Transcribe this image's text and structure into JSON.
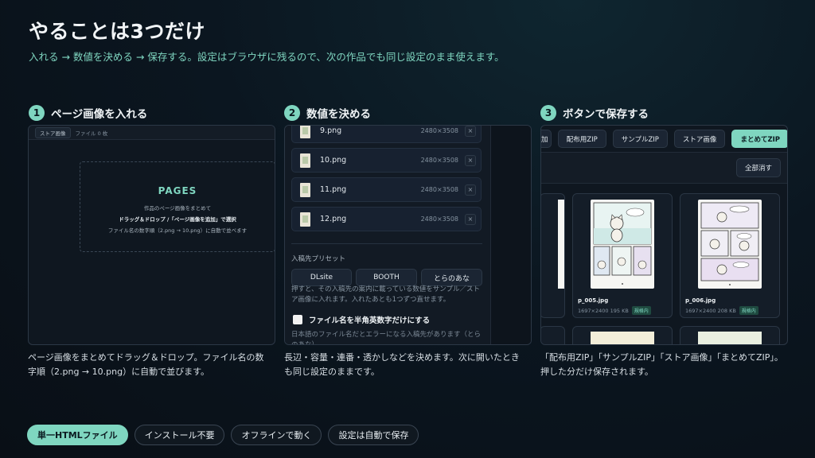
{
  "header": {
    "title": "やることは3つだけ",
    "subtitle": "入れる → 数値を決める → 保存する。設定はブラウザに残るので、次の作品でも同じ設定のまま使えます。"
  },
  "steps": [
    {
      "num": "1",
      "title": "ページ画像を入れる",
      "desc": "ページ画像をまとめてドラッグ＆ドロップ。ファイル名の数字順（2.png → 10.png）に自動で並びます。"
    },
    {
      "num": "2",
      "title": "数値を決める",
      "desc": "長辺・容量・連番・透かしなどを決めます。次に開いたときも同じ設定のままです。"
    },
    {
      "num": "3",
      "title": "ボタンで保存する",
      "desc": "「配布用ZIP」「サンプルZIP」「ストア画像」「まとめてZIP」。押した分だけ保存されます。"
    }
  ],
  "panel1": {
    "tab": "ストア画像",
    "count": "ファイル 0 枚",
    "drop_title": "PAGES",
    "drop_line1": "作品のページ画像をまとめて",
    "drop_line2": "ドラッグ＆ドロップ /「ページ画像を追加」で選択",
    "drop_line3": "ファイル名の数字順（2.png → 10.png）に自動で並べます"
  },
  "panel2": {
    "files": [
      {
        "name": "9.png",
        "size": "2480×3508"
      },
      {
        "name": "10.png",
        "size": "2480×3508"
      },
      {
        "name": "11.png",
        "size": "2480×3508"
      },
      {
        "name": "12.png",
        "size": "2480×3508"
      }
    ],
    "remove_symbol": "×",
    "preset_label": "入稿先プリセット",
    "presets": [
      "DLsite",
      "BOOTH",
      "とらのあな"
    ],
    "preset_note": "押すと、その入稿先の案内に載っている数値をサンプル／ストア画像に入れます。入れたあとも1つずつ直せます。",
    "checkbox_label": "ファイル名を半角英数字だけにする",
    "checkbox_note": "日本語のファイル名だとエラーになる入稿先があります（とらのあな）"
  },
  "panel3": {
    "cut_tab": "加",
    "buttons": [
      "配布用ZIP",
      "サンプルZIP",
      "ストア画像",
      "まとめてZIP"
    ],
    "clear_label": "全部消す",
    "cards": [
      {
        "name": "p_005.jpg",
        "meta": "1697×2400  195 KB",
        "badge": "規格内"
      },
      {
        "name": "p_006.jpg",
        "meta": "1697×2400  208 KB",
        "badge": "規格内"
      }
    ]
  },
  "pills": [
    "単一HTMLファイル",
    "インストール不要",
    "オフラインで動く",
    "設定は自動で保存"
  ],
  "colors": {
    "accent": "#7fd6c0",
    "background": "#0b1620"
  }
}
